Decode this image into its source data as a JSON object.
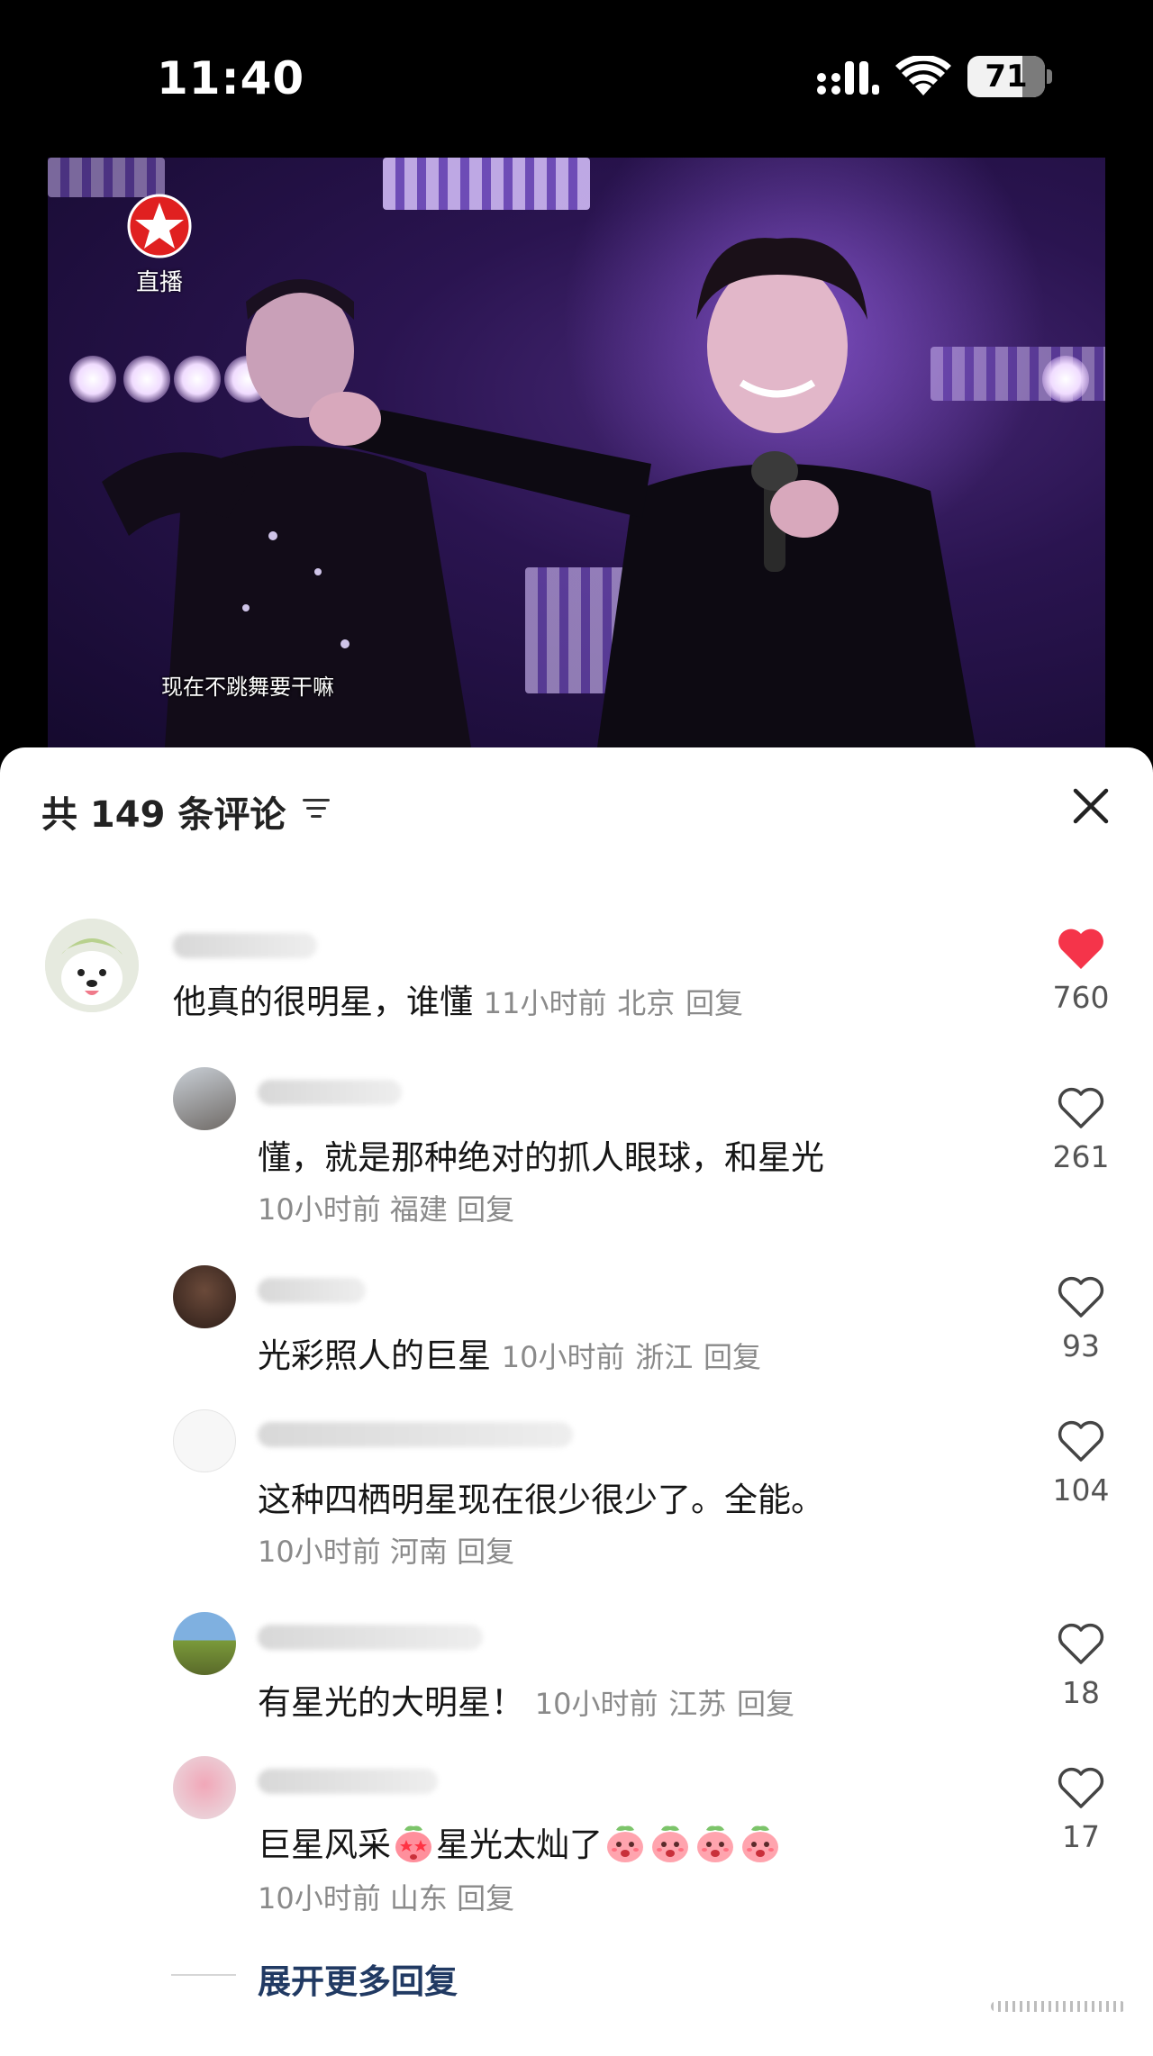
{
  "status_bar": {
    "time": "11:40",
    "battery": "71",
    "battery_level": 0.71,
    "icons": [
      "signal-icon",
      "wifi-icon",
      "battery-icon"
    ]
  },
  "video": {
    "channel_label": "直播",
    "subtitle": "现在不跳舞要干嘛",
    "colors": {
      "stage": "#2a1450",
      "light": "#d9c3ff",
      "logo_red": "#e02020"
    }
  },
  "comments_panel": {
    "title": "共 149 条评论",
    "sort_icon": "sort-filter-icon",
    "close_icon": "close-icon",
    "accent": {
      "liked_heart": "#f5344a",
      "expand_link": "#213a63"
    },
    "comments": [
      {
        "text": "他真的很明星，谁懂",
        "time": "11小时前",
        "location": "北京",
        "reply": "回复",
        "likes": "760",
        "liked": true,
        "level": "top"
      },
      {
        "text": "懂，就是那种绝对的抓人眼球，和星光",
        "time": "10小时前",
        "location": "福建",
        "reply": "回复",
        "likes": "261",
        "liked": false,
        "level": "reply"
      },
      {
        "text": "光彩照人的巨星",
        "time": "10小时前",
        "location": "浙江",
        "reply": "回复",
        "likes": "93",
        "liked": false,
        "level": "reply"
      },
      {
        "text": "这种四栖明星现在很少很少了。全能。",
        "time": "10小时前",
        "location": "河南",
        "reply": "回复",
        "likes": "104",
        "liked": false,
        "level": "reply"
      },
      {
        "text": "有星光的大明星！",
        "time": "10小时前",
        "location": "江苏",
        "reply": "回复",
        "likes": "18",
        "liked": false,
        "level": "reply"
      },
      {
        "text_before": "巨星风采",
        "text_middle": "星光太灿了",
        "emojis": [
          "starry-eyed-peach-emoji",
          "peach-emoji",
          "peach-emoji",
          "peach-emoji",
          "peach-emoji"
        ],
        "time": "10小时前",
        "location": "山东",
        "reply": "回复",
        "likes": "17",
        "liked": false,
        "level": "reply"
      }
    ],
    "expand_more": "展开更多回复"
  }
}
